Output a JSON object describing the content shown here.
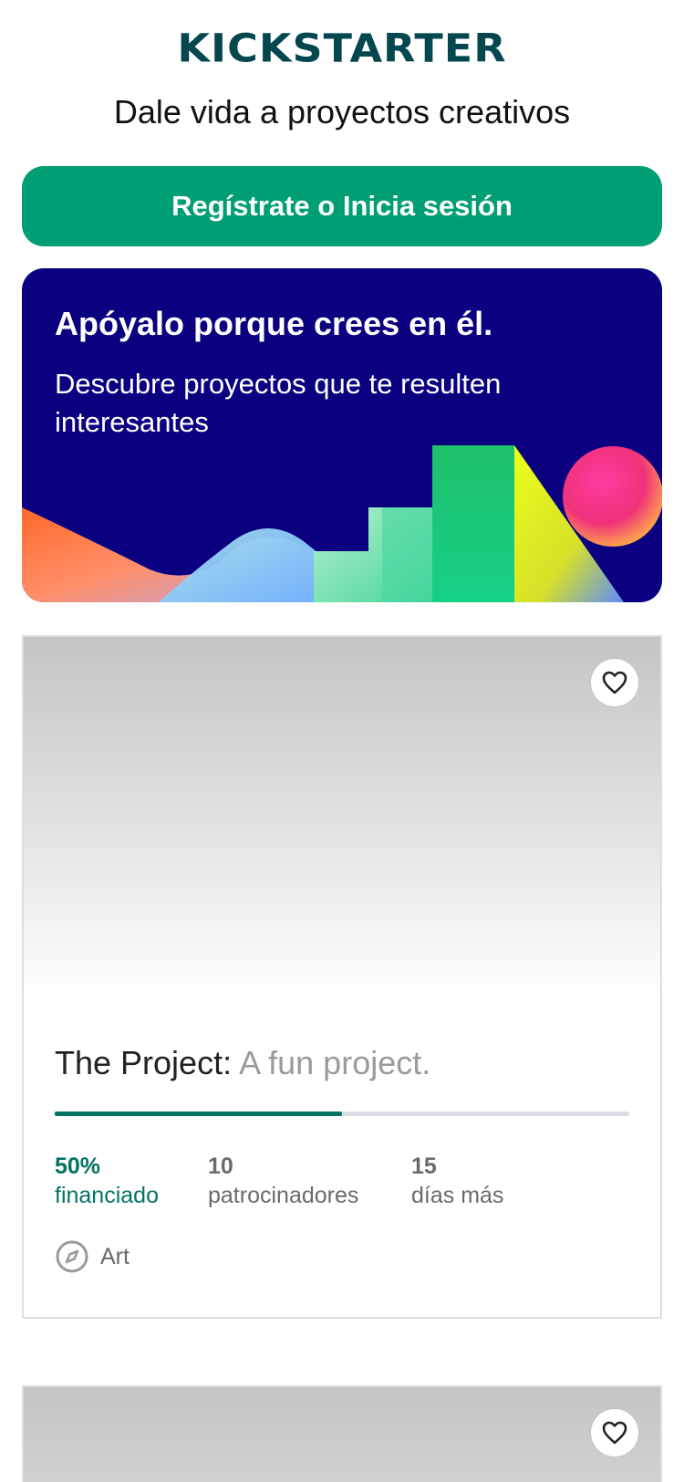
{
  "app": {
    "logo_text": "KICKSTARTER",
    "tagline": "Dale vida a proyectos creativos",
    "brand_color": "#05474f"
  },
  "cta": {
    "label": "Regístrate o Inicia sesión",
    "color": "#009e74"
  },
  "promo": {
    "title": "Apóyalo porque crees en él.",
    "subtitle": "Descubre proyectos que te resulten interesantes",
    "background_color": "#0b0080"
  },
  "projects": [
    {
      "name": "The Project:",
      "blurb": "A fun project.",
      "funded_percent": 50,
      "funded_value": "50%",
      "funded_label": "financiado",
      "backers_value": "10",
      "backers_label": "patrocinadores",
      "days_value": "15",
      "days_label": "días más",
      "category": "Art",
      "favorite_icon": "heart-icon",
      "category_icon": "compass-icon"
    },
    {
      "favorite_icon": "heart-icon"
    }
  ]
}
